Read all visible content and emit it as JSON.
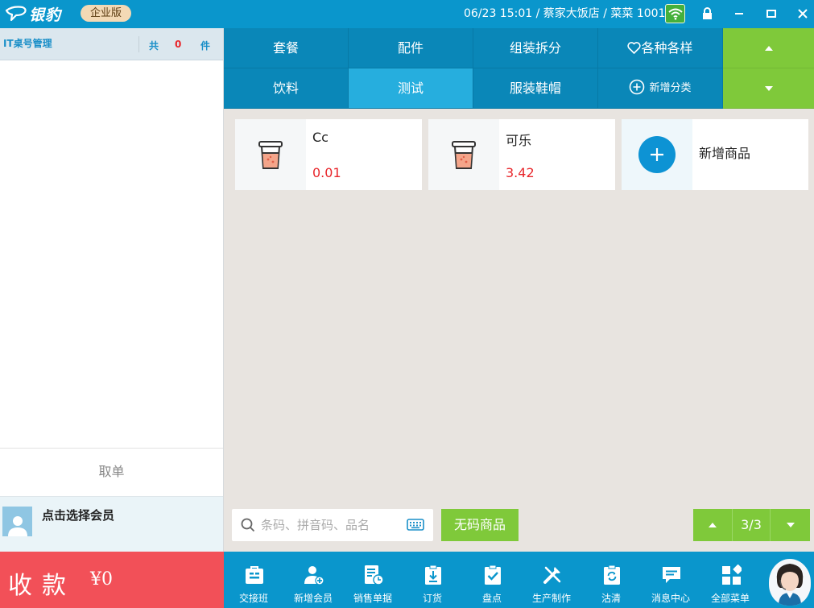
{
  "titlebar": {
    "logo_text": "银豹",
    "edition": "企业版",
    "status": "06/23 15:01 / 蔡家大饭店 / 菜菜 1001"
  },
  "order": {
    "table_mgmt": "IT桌号管理",
    "count_prefix": "共",
    "count": "0",
    "count_suffix": "件",
    "cancel_label": "取单"
  },
  "member": {
    "label": "点击选择会员"
  },
  "pay": {
    "label": "收款",
    "amount": "¥0"
  },
  "categories": [
    {
      "label": "套餐"
    },
    {
      "label": "配件"
    },
    {
      "label": "组装拆分"
    },
    {
      "label": "各种各样"
    },
    {
      "label": "饮料"
    },
    {
      "label": "测试"
    },
    {
      "label": "服装鞋帽"
    },
    {
      "label": "新增分类"
    }
  ],
  "products": [
    {
      "name": "Cc",
      "price": "0.01"
    },
    {
      "name": "可乐",
      "price": "3.42"
    }
  ],
  "add_product": "新增商品",
  "search": {
    "placeholder": "条码、拼音码、品名"
  },
  "no_barcode": "无码商品",
  "pager": {
    "text": "3/3"
  },
  "toolbar": [
    {
      "label": "交接班"
    },
    {
      "label": "新增会员"
    },
    {
      "label": "销售单据"
    },
    {
      "label": "订货"
    },
    {
      "label": "盘点"
    },
    {
      "label": "生产制作"
    },
    {
      "label": "沽清"
    },
    {
      "label": "消息中心"
    },
    {
      "label": "全部菜单"
    }
  ],
  "colors": {
    "brand_blue": "#0a96cc",
    "category_blue": "#0a87b8",
    "active_category": "#26aede",
    "green": "#7fc93a",
    "pay_red": "#f25058",
    "price_red": "#e8262b"
  }
}
